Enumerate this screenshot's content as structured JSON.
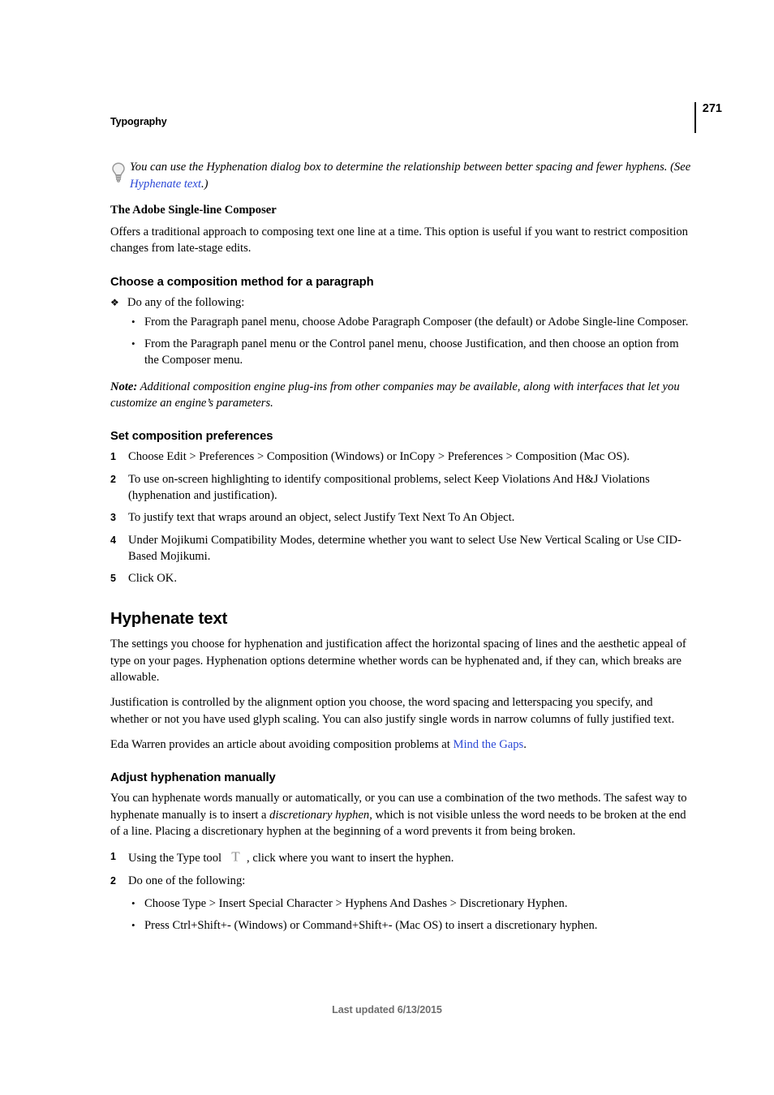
{
  "header": {
    "breadcrumb": "Typography",
    "page_number": "271"
  },
  "tip": {
    "icon": "lightbulb-icon",
    "text_before": "You can use the Hyphenation dialog box to determine the relationship between better spacing and fewer hyphens. (See ",
    "link": "Hyphenate text",
    "text_after": ".)"
  },
  "single_line_composer": {
    "heading": "The Adobe Single-line Composer",
    "paragraph": "Offers a traditional approach to composing text one line at a time. This option is useful if you want to restrict composition changes from late-stage edits."
  },
  "choose_method": {
    "heading": "Choose a composition method for a paragraph",
    "lead": "Do any of the following:",
    "lead_marker": "❖",
    "bullets": [
      "From the Paragraph panel menu, choose Adobe Paragraph Composer (the default) or Adobe Single-line Composer.",
      "From the Paragraph panel menu or the Control panel menu, choose Justification, and then choose an option from the Composer menu."
    ],
    "bullet_marker": "•",
    "note_label": "Note:",
    "note_text": " Additional composition engine plug-ins from other companies may be available, along with interfaces that let you customize an engine’s parameters."
  },
  "set_preferences": {
    "heading": "Set composition preferences",
    "steps": [
      {
        "num": "1",
        "text": "Choose Edit > Preferences > Composition (Windows) or InCopy > Preferences > Composition (Mac OS)."
      },
      {
        "num": "2",
        "text": "To use on-screen highlighting to identify compositional problems, select Keep Violations And H&J Violations (hyphenation and justification)."
      },
      {
        "num": "3",
        "text": "To justify text that wraps around an object, select Justify Text Next To An Object."
      },
      {
        "num": "4",
        "text": "Under Mojikumi Compatibility Modes, determine whether you want to select Use New Vertical Scaling or Use CID-Based Mojikumi."
      },
      {
        "num": "5",
        "text": "Click OK."
      }
    ]
  },
  "hyphenate_text": {
    "heading": "Hyphenate text",
    "paragraph1": "The settings you choose for hyphenation and justification affect the horizontal spacing of lines and the aesthetic appeal of type on your pages. Hyphenation options determine whether words can be hyphenated and, if they can, which breaks are allowable.",
    "paragraph2": "Justification is controlled by the alignment option you choose, the word spacing and letterspacing you specify, and whether or not you have used glyph scaling. You can also justify single words in narrow columns of fully justified text.",
    "paragraph3_before": "Eda Warren provides an article about avoiding composition problems at ",
    "paragraph3_link": "Mind the Gaps",
    "paragraph3_after": "."
  },
  "adjust_hyphenation": {
    "heading": "Adjust hyphenation manually",
    "intro_part1": "You can hyphenate words manually or automatically, or you can use a combination of the two methods. The safest way to hyphenate manually is to insert a ",
    "intro_italic": "discretionary hyphen",
    "intro_part2": ", which is not visible unless the word needs to be broken at the end of a line. Placing a discretionary hyphen at the beginning of a word prevents it from being broken.",
    "step1_num": "1",
    "step1_before": "Using the Type tool",
    "step1_icon": "type-tool-icon",
    "step1_after": ", click where you want to insert the hyphen.",
    "step2_num": "2",
    "step2_text": "Do one of the following:",
    "bullet_marker": "•",
    "bullets": [
      "Choose Type > Insert Special Character > Hyphens And Dashes > Discretionary Hyphen.",
      "Press Ctrl+Shift+- (Windows) or Command+Shift+- (Mac OS) to insert a discretionary hyphen."
    ]
  },
  "footer": {
    "text": "Last updated 6/13/2015"
  },
  "colors": {
    "link": "#2a47d6",
    "footer_text": "#6e6e6e",
    "body_text": "#000000"
  }
}
